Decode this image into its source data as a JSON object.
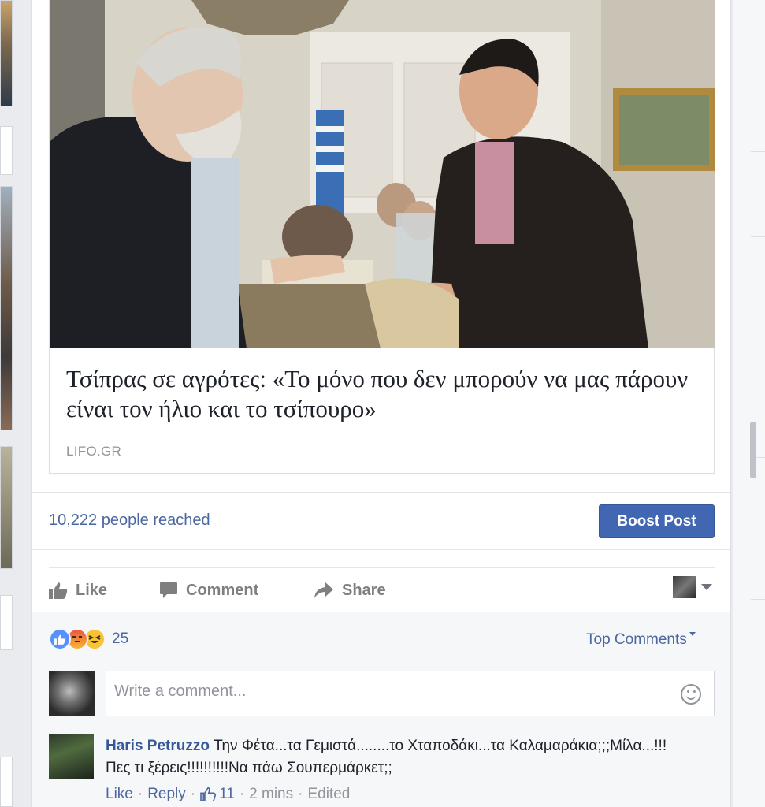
{
  "post": {
    "link": {
      "title": "Τσίπρας σε αγρότες: «Το μόνο που δεν μπορούν να μας πάρουν είναι τον ήλιο και το τσίπουρο»",
      "source": "LIFO.GR"
    },
    "reach": "10,222 people reached",
    "boost_label": "Boost Post",
    "actions": {
      "like": "Like",
      "comment": "Comment",
      "share": "Share"
    },
    "reactions": {
      "count": "25",
      "types": [
        "like",
        "angry",
        "haha"
      ]
    },
    "top_comments_label": "Top Comments",
    "comment_input_placeholder": "Write a comment...",
    "comments": [
      {
        "author": "Haris Petruzzo",
        "text": "Την Φέτα...τα Γεμιστά........το Χταποδάκι...τα Καλαμαράκια;;;Μίλα...!!! Πες τι ξέρεις!!!!!!!!!!Να πάω Σουπερμάρκετ;;",
        "like_label": "Like",
        "reply_label": "Reply",
        "likes": "11",
        "time": "2 mins",
        "edited": "Edited"
      }
    ]
  },
  "colors": {
    "facebook_blue": "#4267b2",
    "link_blue": "#4b67a1",
    "author_blue": "#365899",
    "muted_gray": "#90949c",
    "action_gray": "#7f7f7f"
  },
  "icons": [
    "thumbs-up-icon",
    "comment-bubble-icon",
    "share-arrow-icon",
    "smiley-icon",
    "caret-down-icon"
  ]
}
